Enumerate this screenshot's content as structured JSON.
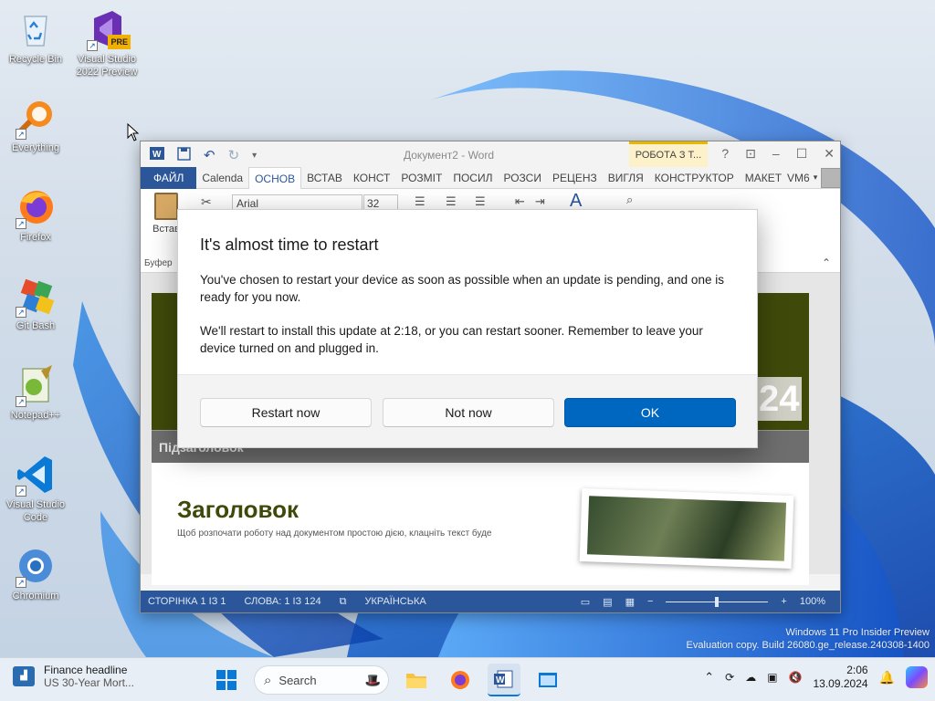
{
  "desktop": {
    "icons": [
      {
        "label": "Recycle Bin"
      },
      {
        "label": "Visual Studio 2022 Preview",
        "badge": "PRE"
      },
      {
        "label": "Everything"
      },
      {
        "label": "Firefox"
      },
      {
        "label": "Git Bash"
      },
      {
        "label": "Notepad++"
      },
      {
        "label": "Visual Studio Code"
      },
      {
        "label": "Chromium"
      }
    ],
    "watermark": {
      "line1": "Windows 11 Pro Insider Preview",
      "line2": "Evaluation copy. Build 26080.ge_release.240308-1400"
    }
  },
  "word": {
    "title": "Документ2 - Word",
    "contextual_tab": "РОБОТА З Т...",
    "window_controls": {
      "help": "?",
      "ribbon_display": "⊡",
      "minimize": "–",
      "maximize": "☐",
      "close": "✕"
    },
    "tabs": [
      "ФАЙЛ",
      "Calenda",
      "ОСНОВ",
      "ВСТАВ",
      "КОНСТ",
      "РОЗМІТ",
      "ПОСИЛ",
      "РОЗСИ",
      "РЕЦЕНЗ",
      "ВИГЛЯ",
      "КОНСТРУКТОР",
      "МАКЕТ"
    ],
    "active_tab": "ОСНОВ",
    "user": "VM6",
    "font_name": "Arial",
    "font_size": "32",
    "paste_label": "Встав",
    "clipboard_group": "Буфер",
    "document": {
      "year": "2024",
      "subheading": "Підзаголовок",
      "heading": "Заголовок",
      "body_snippet": "Щоб розпочати роботу над документом простою дією, клацніть текст буде"
    },
    "status": {
      "page": "СТОРІНКА 1 ІЗ 1",
      "words": "СЛОВА: 1 ІЗ 124",
      "language": "УКРАЇНСЬКА",
      "zoom_minus": "−",
      "zoom_plus": "+",
      "zoom": "100%",
      "zoom_level": 0.5
    }
  },
  "dialog": {
    "title": "It's almost time to restart",
    "paragraph1": "You've chosen to restart your device as soon as possible when an update is pending, and one is ready for you now.",
    "paragraph2": "We'll restart to install this update at 2:18, or you can restart sooner. Remember to leave your device turned on and plugged in.",
    "buttons": {
      "restart_now": "Restart now",
      "not_now": "Not now",
      "ok": "OK"
    },
    "accent_color": "#0067c0"
  },
  "taskbar": {
    "widget": {
      "title": "Finance headline",
      "subtitle": "US 30-Year Mort..."
    },
    "search_placeholder": "Search",
    "clock": {
      "time": "2:06",
      "date": "13.09.2024"
    },
    "tray_icons": [
      "chevron-up-icon",
      "sync-icon",
      "cloud-off-icon",
      "display-icon",
      "sound-muted-icon",
      "notification-icon",
      "copilot-icon"
    ]
  }
}
